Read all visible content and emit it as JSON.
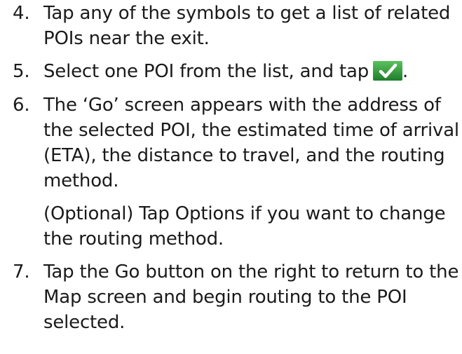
{
  "steps": [
    {
      "number": "4.",
      "text": "Tap any of the symbols to get a list of related POIs near the exit."
    },
    {
      "number": "5.",
      "text_before_icon": "Select one POI from the list, and tap",
      "icon": "checkmark-ok-icon",
      "text_after_icon": "."
    },
    {
      "number": "6.",
      "text": "The ‘Go’ screen appears with the address of the selected POI, the estimated time of arrival (ETA), the distance to travel, and the routing method.",
      "note": "(Optional) Tap Options if you want to change the routing method."
    },
    {
      "number": "7.",
      "text": "Tap the Go button on the right to return to the Map screen and begin routing to the POI selected."
    }
  ],
  "colors": {
    "text": "#1a1a1a",
    "icon_background": "#2f9a3c",
    "icon_check": "#ffffff"
  }
}
